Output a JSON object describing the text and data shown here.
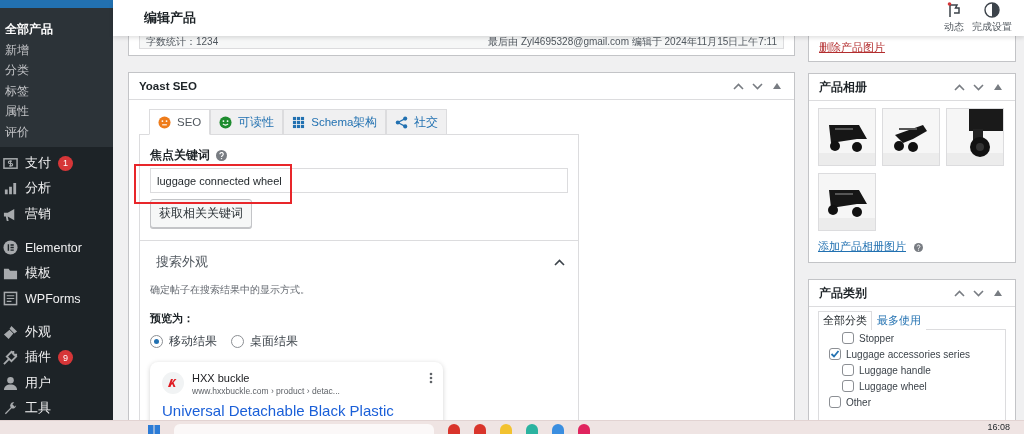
{
  "sidebar": {
    "submenu": [
      {
        "label": "全部产品",
        "selected": true
      },
      {
        "label": "新增",
        "selected": false
      },
      {
        "label": "分类",
        "selected": false
      },
      {
        "label": "标签",
        "selected": false
      },
      {
        "label": "属性",
        "selected": false
      },
      {
        "label": "评价",
        "selected": false
      }
    ],
    "menu_groups": [
      {
        "items": [
          {
            "label": "支付",
            "badge": "1"
          },
          {
            "label": "分析"
          },
          {
            "label": "营销"
          }
        ]
      },
      {
        "items": [
          {
            "label": "Elementor"
          },
          {
            "label": "模板"
          },
          {
            "label": "WPForms"
          }
        ]
      },
      {
        "items": [
          {
            "label": "外观"
          },
          {
            "label": "插件",
            "badge": "9"
          },
          {
            "label": "用户"
          },
          {
            "label": "工具"
          }
        ]
      }
    ]
  },
  "header": {
    "title": "编辑产品",
    "actions": [
      {
        "label": "动态"
      },
      {
        "label": "完成设置"
      }
    ]
  },
  "editor_status": {
    "word_count": "字数统计：1234",
    "last_edited": "最后由 Zyl4695328@gmail.com 编辑于 2024年11月15日上午7:11"
  },
  "yoast": {
    "title": "Yoast SEO",
    "tabs": [
      {
        "label": "SEO",
        "selected": true
      },
      {
        "label": "可读性",
        "selected": false
      },
      {
        "label": "Schema架构",
        "selected": false
      },
      {
        "label": "社交",
        "selected": false
      }
    ],
    "focus_keyphrase": {
      "label": "焦点关键词",
      "value": "luggage connected wheel"
    },
    "related_button": "获取相关关键词",
    "search_appearance": {
      "title": "搜索外观",
      "expanded": true,
      "description": "确定帖子在搜索结果中的显示方式。",
      "preview_label": "预览为：",
      "options": [
        {
          "label": "移动结果",
          "selected": true
        },
        {
          "label": "桌面结果",
          "selected": false
        }
      ],
      "snippet": {
        "site": "HXX buckle",
        "url": "www.hxxbuckle.com › product › detac...",
        "title": "Universal Detachable Black Plastic"
      }
    }
  },
  "featured_image": {
    "remove_link": "删除产品图片"
  },
  "gallery": {
    "title": "产品相册",
    "add_link": "添加产品相册图片"
  },
  "categories": {
    "title": "产品类别",
    "tabs": [
      {
        "label": "全部分类",
        "selected": true
      },
      {
        "label": "最多使用",
        "selected": false
      }
    ],
    "items": [
      {
        "children": [
          {
            "label": "Stopper",
            "checked": false
          }
        ]
      },
      {
        "label": "Luggage accessories series",
        "checked": true,
        "children": [
          {
            "label": "Luggage handle",
            "checked": false
          },
          {
            "label": "Luggage wheel",
            "checked": false
          }
        ]
      },
      {
        "label": "Other",
        "checked": false
      }
    ]
  },
  "taskbar": {
    "time": "16:08"
  }
}
